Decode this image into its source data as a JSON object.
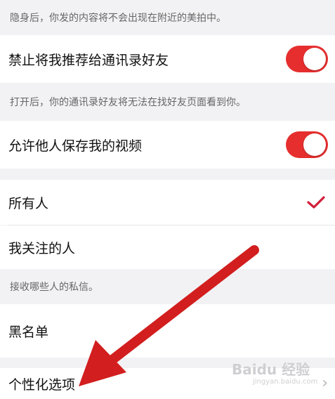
{
  "settings": {
    "hint_nearby": "隐身后，你发的内容将不会出现在附近的美拍中。",
    "row_contacts_label": "禁止将我推荐给通讯录好友",
    "hint_contacts": "打开后，你的通讯录好友将无法在找好友页面看到你。",
    "row_save_video_label": "允许他人保存我的视频",
    "option_everyone": "所有人",
    "option_following": "我关注的人",
    "hint_messages": "接收哪些人的私信。",
    "row_blacklist": "黑名单",
    "row_personalization": "个性化选项"
  },
  "toggles": {
    "contacts_on": true,
    "save_video_on": true
  },
  "watermark": {
    "brand": "Baidu 经验",
    "url": "jingyan.baidu.com"
  },
  "colors": {
    "accent": "#e62e2e",
    "background": "#f2f2f4",
    "arrow": "#d21e1e"
  },
  "icons": {
    "selected": "checkmark-icon",
    "navigate": "chevron-right-icon"
  }
}
